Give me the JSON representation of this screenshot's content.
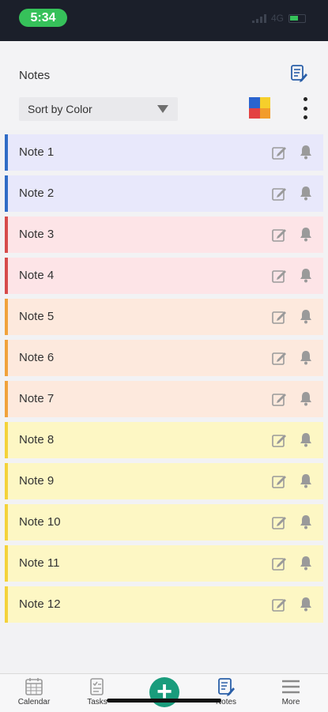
{
  "status_bar": {
    "time": "5:34",
    "network": "4G"
  },
  "header": {
    "title": "Notes",
    "sort_label": "Sort by Color",
    "icons": [
      "note-edit-icon",
      "color-grid-icon",
      "more-vertical-icon"
    ]
  },
  "colors": {
    "blue": "#2f6cc6",
    "blue_bg": "#e8e8fb",
    "red": "#d64b4b",
    "red_bg": "#fde4e7",
    "orange": "#f0a23c",
    "orange_bg": "#fde9dd",
    "yellow": "#f4d23a",
    "yellow_bg": "#fdf7c4",
    "accent": "#199c7c"
  },
  "notes": [
    {
      "title": "Note 1",
      "color": "blue"
    },
    {
      "title": "Note 2",
      "color": "blue"
    },
    {
      "title": "Note 3",
      "color": "red"
    },
    {
      "title": "Note 4",
      "color": "red"
    },
    {
      "title": "Note 5",
      "color": "orange"
    },
    {
      "title": "Note 6",
      "color": "orange"
    },
    {
      "title": "Note 7",
      "color": "orange"
    },
    {
      "title": "Note 8",
      "color": "yellow"
    },
    {
      "title": "Note 9",
      "color": "yellow"
    },
    {
      "title": "Note 10",
      "color": "yellow"
    },
    {
      "title": "Note 11",
      "color": "yellow"
    },
    {
      "title": "Note 12",
      "color": "yellow"
    }
  ],
  "bottom_nav": {
    "calendar": "Calendar",
    "tasks": "Tasks",
    "add": "+",
    "notes": "Notes",
    "more": "More"
  }
}
